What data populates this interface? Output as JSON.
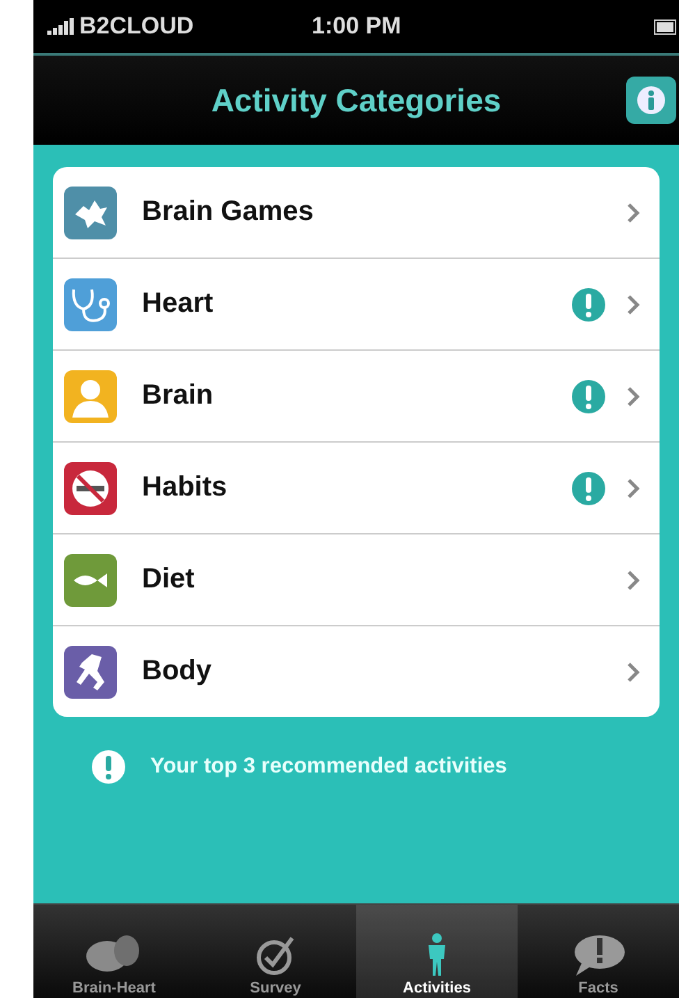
{
  "status_bar": {
    "carrier": "B2CLOUD",
    "time": "1:00 PM"
  },
  "nav_bar": {
    "title": "Activity Categories"
  },
  "categories": [
    {
      "label": "Brain Games",
      "kind": "puzzle",
      "color": "#4f8fa8",
      "recommended": false
    },
    {
      "label": "Heart",
      "kind": "stethoscope",
      "color": "#4f9fd8",
      "recommended": true
    },
    {
      "label": "Brain",
      "kind": "person",
      "color": "#f2b320",
      "recommended": true
    },
    {
      "label": "Habits",
      "kind": "prohibition",
      "color": "#c8283c",
      "recommended": true
    },
    {
      "label": "Diet",
      "kind": "fish",
      "color": "#6f9a3a",
      "recommended": false
    },
    {
      "label": "Body",
      "kind": "runner",
      "color": "#6a5ea8",
      "recommended": false
    }
  ],
  "legend": "Your top 3 recommended activities",
  "tab_bar": [
    {
      "label": "Brain-Heart",
      "kind": "organs",
      "selected": false
    },
    {
      "label": "Survey",
      "kind": "check",
      "selected": false
    },
    {
      "label": "Activities",
      "kind": "figure",
      "selected": true
    },
    {
      "label": "Facts",
      "kind": "speech",
      "selected": false
    }
  ]
}
